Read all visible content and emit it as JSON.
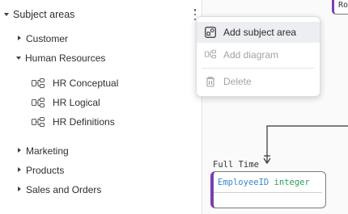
{
  "sidebar": {
    "root_label": "Subject areas",
    "items": [
      {
        "label": "Customer",
        "expanded": false
      },
      {
        "label": "Human Resources",
        "expanded": true,
        "children": [
          {
            "label": "HR Conceptual",
            "icon": "diagram-icon"
          },
          {
            "label": "HR Logical",
            "icon": "diagram-icon"
          },
          {
            "label": "HR Definitions",
            "icon": "diagram-icon"
          }
        ]
      },
      {
        "label": "Marketing",
        "expanded": false
      },
      {
        "label": "Products",
        "expanded": false
      },
      {
        "label": "Sales and Orders",
        "expanded": false
      }
    ]
  },
  "context_menu": {
    "items": [
      {
        "label": "Add subject area",
        "icon": "subject-area-icon",
        "state": "active"
      },
      {
        "label": "Add diagram",
        "icon": "diagram-icon",
        "state": "disabled"
      },
      {
        "label": "Delete",
        "icon": "trash-icon",
        "state": "disabled"
      }
    ]
  },
  "canvas": {
    "top_entity_label": "Ro",
    "entity_title": "Full Time",
    "entity_field_name": "EmployeeID",
    "entity_field_type": "integer"
  },
  "colors": {
    "accent_purple": "#7b3fb0",
    "field_name_blue": "#3a86c8",
    "field_type_green": "#2e9e5a"
  }
}
